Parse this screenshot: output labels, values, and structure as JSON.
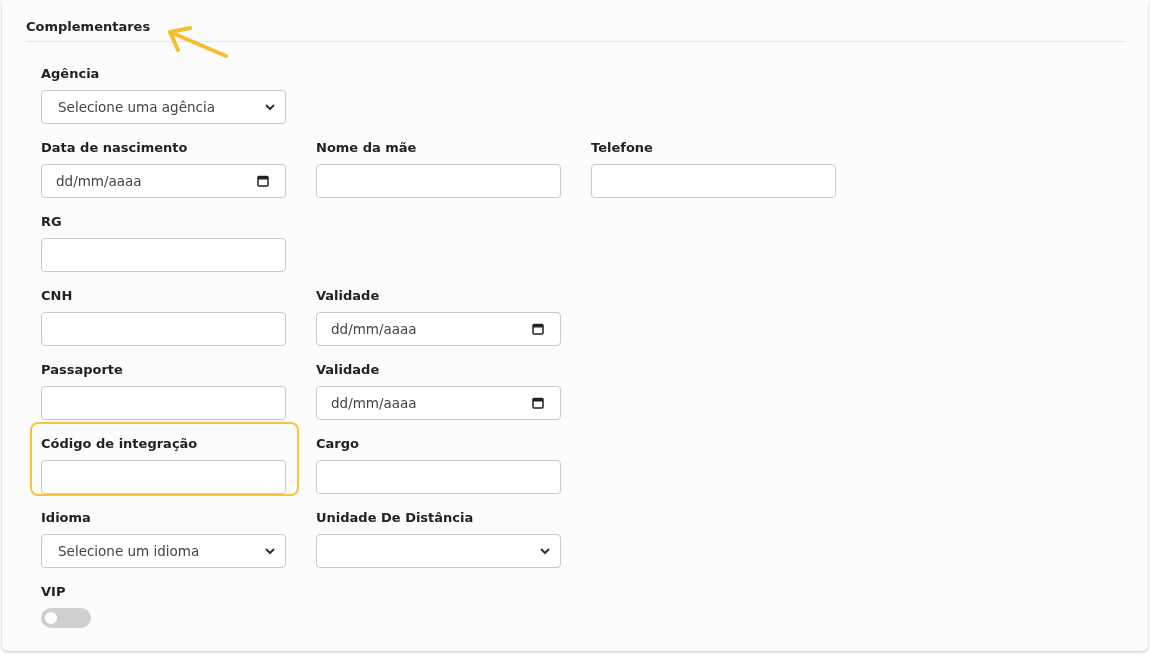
{
  "section": {
    "title": "Complementares",
    "arrow": true
  },
  "rows": [
    [
      {
        "kind": "select",
        "label": "Agência",
        "value": "Selecione uma agência"
      }
    ],
    [
      {
        "kind": "date",
        "label": "Data de nascimento",
        "placeholder": "dd/mm/aaaa"
      },
      {
        "kind": "text",
        "label": "Nome da mãe"
      },
      {
        "kind": "text",
        "label": "Telefone"
      }
    ],
    [
      {
        "kind": "text",
        "label": "RG"
      }
    ],
    [
      {
        "kind": "text",
        "label": "CNH"
      },
      {
        "kind": "date",
        "label": "Validade",
        "placeholder": "dd/mm/aaaa"
      }
    ],
    [
      {
        "kind": "text",
        "label": "Passaporte"
      },
      {
        "kind": "date",
        "label": "Validade",
        "placeholder": "dd/mm/aaaa"
      }
    ],
    [
      {
        "kind": "text",
        "label": "Código de integração",
        "highlighted": true
      },
      {
        "kind": "text",
        "label": "Cargo"
      }
    ],
    [
      {
        "kind": "select",
        "label": "Idioma",
        "value": "Selecione um idioma"
      },
      {
        "kind": "select",
        "label": "Unidade De Distância"
      }
    ],
    [
      {
        "kind": "toggle",
        "label": "VIP",
        "on": false
      }
    ]
  ]
}
